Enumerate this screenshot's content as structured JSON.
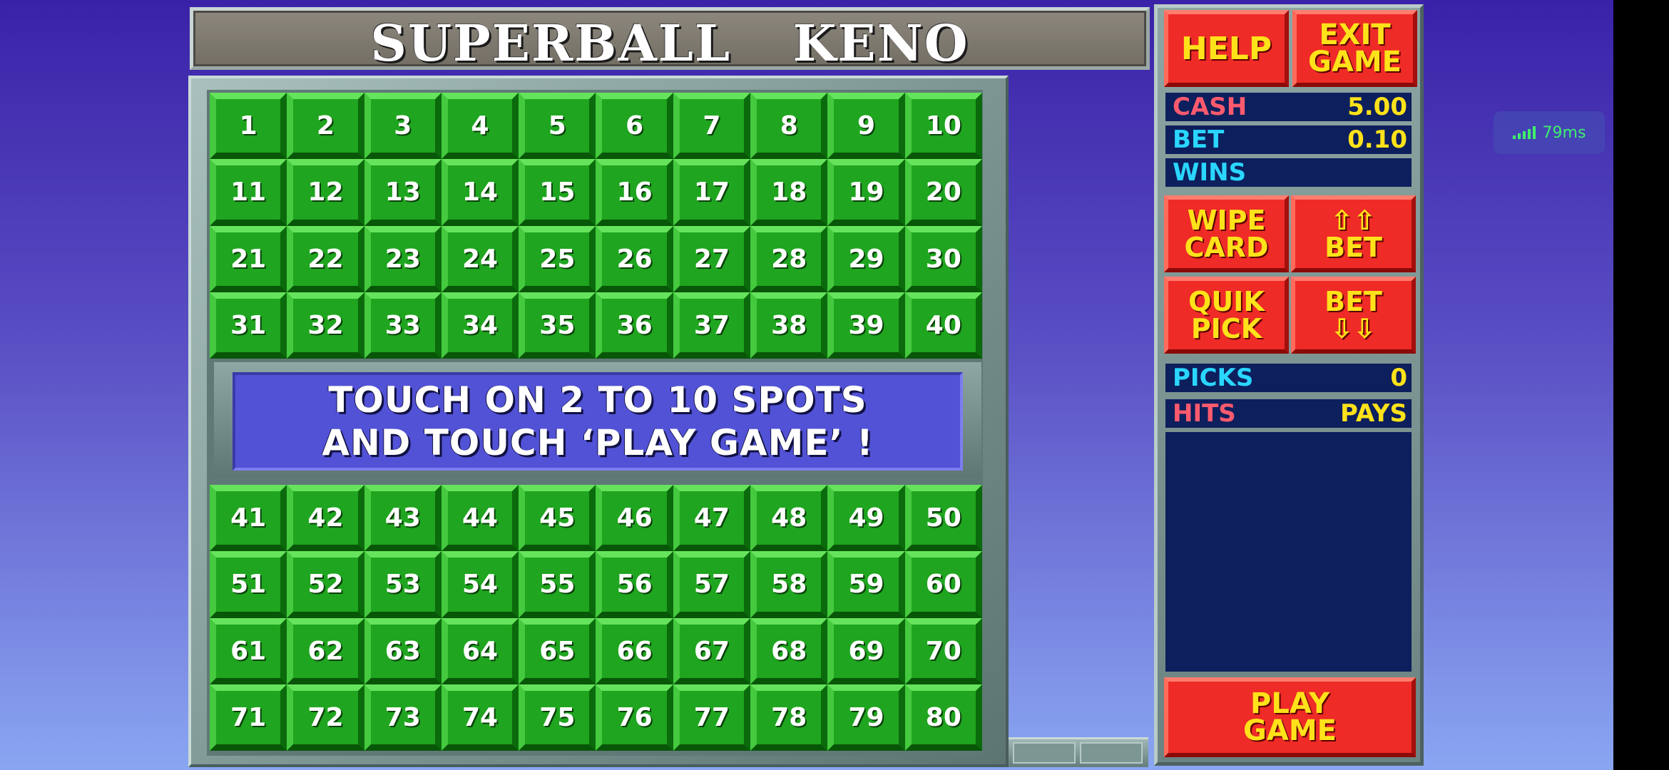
{
  "title": "SUPERBALL KENO",
  "title_parts": [
    "SUPERBALL",
    "KENO"
  ],
  "board": {
    "top_numbers": [
      "1",
      "2",
      "3",
      "4",
      "5",
      "6",
      "7",
      "8",
      "9",
      "10",
      "11",
      "12",
      "13",
      "14",
      "15",
      "16",
      "17",
      "18",
      "19",
      "20",
      "21",
      "22",
      "23",
      "24",
      "25",
      "26",
      "27",
      "28",
      "29",
      "30",
      "31",
      "32",
      "33",
      "34",
      "35",
      "36",
      "37",
      "38",
      "39",
      "40"
    ],
    "bottom_numbers": [
      "41",
      "42",
      "43",
      "44",
      "45",
      "46",
      "47",
      "48",
      "49",
      "50",
      "51",
      "52",
      "53",
      "54",
      "55",
      "56",
      "57",
      "58",
      "59",
      "60",
      "61",
      "62",
      "63",
      "64",
      "65",
      "66",
      "67",
      "68",
      "69",
      "70",
      "71",
      "72",
      "73",
      "74",
      "75",
      "76",
      "77",
      "78",
      "79",
      "80"
    ],
    "message_line1": "TOUCH ON 2 TO 10 SPOTS",
    "message_line2": "AND TOUCH ‘PLAY GAME’ !"
  },
  "panel": {
    "help": "HELP",
    "exit_line1": "EXIT",
    "exit_line2": "GAME",
    "cash_label": "CASH",
    "cash_value": "5.00",
    "bet_label": "BET",
    "bet_value": "0.10",
    "wins_label": "WINS",
    "wipe_line1": "WIPE",
    "wipe_line2": "CARD",
    "bet_up_arrows": "⇧⇧",
    "bet_up_label": "BET",
    "quik_line1": "QUIK",
    "quik_line2": "PICK",
    "bet_down_label": "BET",
    "bet_down_arrows": "⇩⇩",
    "picks_label": "PICKS",
    "picks_value": "0",
    "hits_label": "HITS",
    "pays_label": "PAYS",
    "play_line1": "PLAY",
    "play_line2": "GAME"
  },
  "network": {
    "latency": "79ms",
    "icon": "signal-bars-icon"
  },
  "colors": {
    "cell_green": "#1fa51f",
    "button_red": "#ee2b27",
    "button_text": "#ffe21a",
    "panel_navy": "#0d1f5c",
    "message_bg": "#5252d6"
  }
}
